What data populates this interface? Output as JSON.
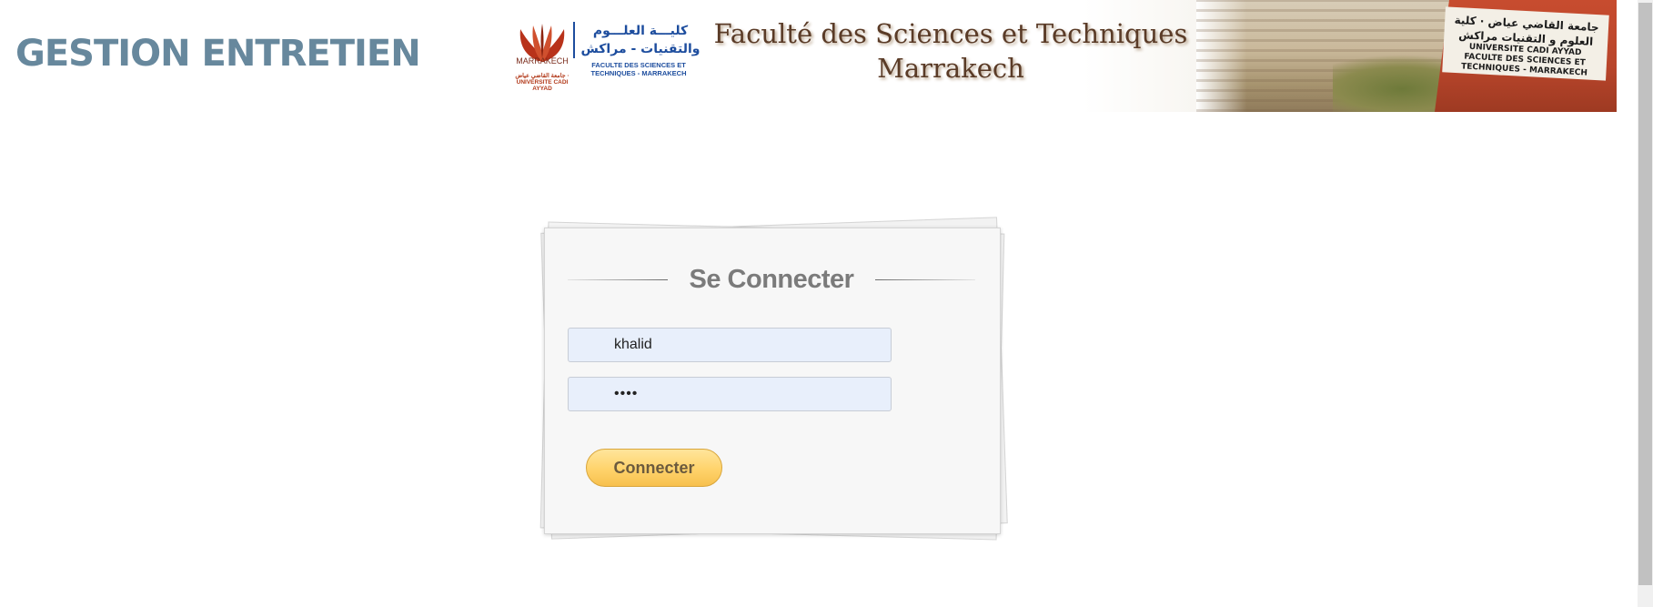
{
  "app": {
    "title": "GESTION ENTRETIEN"
  },
  "banner": {
    "logo_city": "MARRAKECH",
    "logo_university": "جامعة القاضي عياض · UNIVERSITE CADI AYYAD",
    "arabic_name": "كليـــة العلـــوم والتقنيات - مراكش",
    "french_small": "FACULTE DES SCIENCES ET TECHNIQUES - MARRAKECH",
    "headline_line1": "Faculté des Sciences et Techniques",
    "headline_line2": "Marrakech",
    "photo_sign_arabic": "جامعة القاضي عياض · كلية العلوم و التقنيات مراكش",
    "photo_sign_line1": "UNIVERSITE CADI AYYAD",
    "photo_sign_line2": "FACULTE DES SCIENCES ET TECHNIQUES - MARRAKECH"
  },
  "login": {
    "title": "Se Connecter",
    "username_value": "khalid",
    "password_value": "••••",
    "submit_label": "Connecter"
  },
  "colors": {
    "title": "#67889d",
    "field_bg": "#e8effb",
    "button_top": "#ffe59b",
    "button_bottom": "#f7c04e",
    "button_text": "#6b5a3e"
  }
}
